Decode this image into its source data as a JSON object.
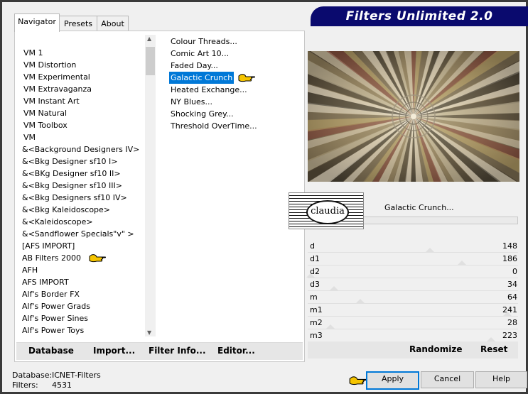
{
  "window": {
    "title": "Filters Unlimited 2.0"
  },
  "tabs": [
    {
      "label": "Navigator",
      "active": true
    },
    {
      "label": "Presets",
      "active": false
    },
    {
      "label": "About",
      "active": false
    }
  ],
  "categories": [
    "VM 1",
    "VM Distortion",
    "VM Experimental",
    "VM Extravaganza",
    "VM Instant Art",
    "VM Natural",
    "VM Toolbox",
    "VM",
    "&<Background Designers IV>",
    "&<Bkg Designer sf10 I>",
    "&<BKg Designer sf10 II>",
    "&<Bkg Designer sf10 III>",
    "&<Bkg Designers sf10 IV>",
    "&<Bkg Kaleidoscope>",
    "&<Kaleidoscope>",
    "&<Sandflower Specials\"v\" >",
    "[AFS IMPORT]",
    "AB Filters 2000",
    "AFH",
    "AFS IMPORT",
    "Alf's Border FX",
    "Alf's Power Grads",
    "Alf's Power Sines",
    "Alf's Power Toys"
  ],
  "filters": [
    "Colour Threads...",
    "Comic Art 10...",
    "Faded Day...",
    "Galactic Crunch",
    "Heated Exchange...",
    "NY Blues...",
    "Shocking Grey...",
    "Threshold OverTime..."
  ],
  "selected_filter_index": 3,
  "left_buttons": {
    "database": "Database",
    "import": "Import...",
    "filter_info": "Filter Info...",
    "editor": "Editor..."
  },
  "preview": {
    "filter_name": "Galactic Crunch...",
    "watermark_text": "claudia"
  },
  "params": [
    {
      "label": "d",
      "value": "148"
    },
    {
      "label": "d1",
      "value": "186"
    },
    {
      "label": "d2",
      "value": "0"
    },
    {
      "label": "d3",
      "value": "34"
    },
    {
      "label": "m",
      "value": "64"
    },
    {
      "label": "m1",
      "value": "241"
    },
    {
      "label": "m2",
      "value": "28"
    },
    {
      "label": "m3",
      "value": "223"
    }
  ],
  "right_buttons": {
    "randomize": "Randomize",
    "reset": "Reset"
  },
  "status": {
    "database_label": "Database:",
    "database_value": "ICNET-Filters",
    "filters_label": "Filters:",
    "filters_value": "4531"
  },
  "dialog_buttons": {
    "apply": "Apply",
    "cancel": "Cancel",
    "help": "Help"
  },
  "colors": {
    "selection": "#0078d7",
    "banner": "#0a0a6e",
    "hand_pointer": "#f5c400"
  }
}
